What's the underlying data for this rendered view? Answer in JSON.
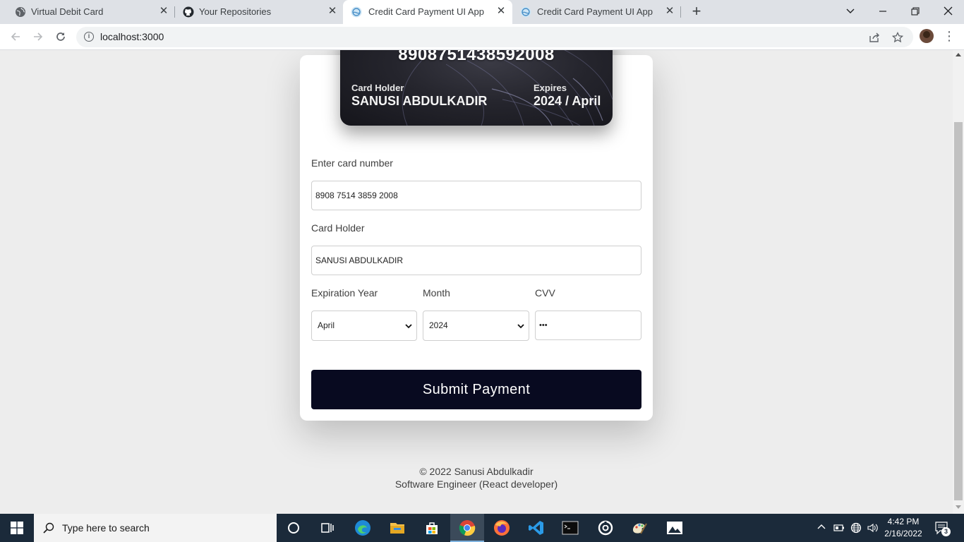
{
  "browser": {
    "tabs": [
      {
        "title": "Virtual Debit Card",
        "favicon": "globe-icon",
        "active": false
      },
      {
        "title": "Your Repositories",
        "favicon": "github-icon",
        "active": false
      },
      {
        "title": "Credit Card Payment UI App",
        "favicon": "react-app-icon",
        "active": true
      },
      {
        "title": "Credit Card Payment UI App",
        "favicon": "react-app-icon",
        "active": false
      }
    ],
    "url": "localhost:3000"
  },
  "card_preview": {
    "number": "8908751438592008",
    "holder_label": "Card Holder",
    "holder_value": "SANUSI ABDULKADIR",
    "expires_label": "Expires",
    "expires_value": "2024 / April"
  },
  "form": {
    "card_number_label": "Enter card number",
    "card_number_value": "8908 7514 3859 2008",
    "card_holder_label": "Card Holder",
    "card_holder_value": "SANUSI ABDULKADIR",
    "expiration_year_label": "Expiration Year",
    "expiration_year_value": "April",
    "month_label": "Month",
    "month_value": "2024",
    "cvv_label": "CVV",
    "cvv_value": "•••",
    "submit_label": "Submit Payment",
    "submit_color": "#080a20"
  },
  "footer": {
    "copyright": "© 2022 Sanusi Abdulkadir",
    "role": "Software Engineer (React developer)"
  },
  "taskbar": {
    "search_placeholder": "Type here to search",
    "time": "4:42 PM",
    "date": "2/16/2022",
    "notifications": "3"
  }
}
